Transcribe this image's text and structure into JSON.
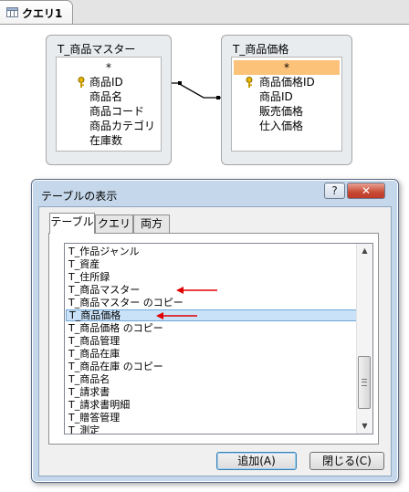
{
  "doc_tab": {
    "title": "クエリ1",
    "icon": "query-icon"
  },
  "design_tables": [
    {
      "title": "T_商品マスター",
      "fields": [
        {
          "name": "*",
          "key": false,
          "selected": false
        },
        {
          "name": "商品ID",
          "key": true,
          "selected": false
        },
        {
          "name": "商品名",
          "key": false,
          "selected": false
        },
        {
          "name": "商品コード",
          "key": false,
          "selected": false
        },
        {
          "name": "商品カテゴリ",
          "key": false,
          "selected": false
        },
        {
          "name": "在庫数",
          "key": false,
          "selected": false
        }
      ]
    },
    {
      "title": "T_商品価格",
      "fields": [
        {
          "name": "*",
          "key": false,
          "selected": true
        },
        {
          "name": "商品価格ID",
          "key": true,
          "selected": false
        },
        {
          "name": "商品ID",
          "key": false,
          "selected": false
        },
        {
          "name": "販売価格",
          "key": false,
          "selected": false
        },
        {
          "name": "仕入価格",
          "key": false,
          "selected": false
        }
      ]
    }
  ],
  "dialog": {
    "title": "テーブルの表示",
    "help_label": "?",
    "close_label": "✕",
    "tabs": [
      {
        "label": "テーブル",
        "active": true
      },
      {
        "label": "クエリ",
        "active": false
      },
      {
        "label": "両方",
        "active": false
      }
    ],
    "tables": [
      "T_作品ジャンル",
      "T_資産",
      "T_住所録",
      "T_商品マスター",
      "T_商品マスター のコピー",
      "T_商品価格",
      "T_商品価格 のコピー",
      "T_商品管理",
      "T_商品在庫",
      "T_商品在庫 のコピー",
      "T_商品名",
      "T_請求書",
      "T_請求書明細",
      "T_贈答管理",
      "T_測定"
    ],
    "selected_table": "T_商品価格",
    "add_button": "追加(A)",
    "close_button": "閉じる(C)"
  },
  "colors": {
    "field_highlight": "#fdc27a",
    "list_selection": "#c9e2f8",
    "annotation_arrow": "#e00000"
  }
}
